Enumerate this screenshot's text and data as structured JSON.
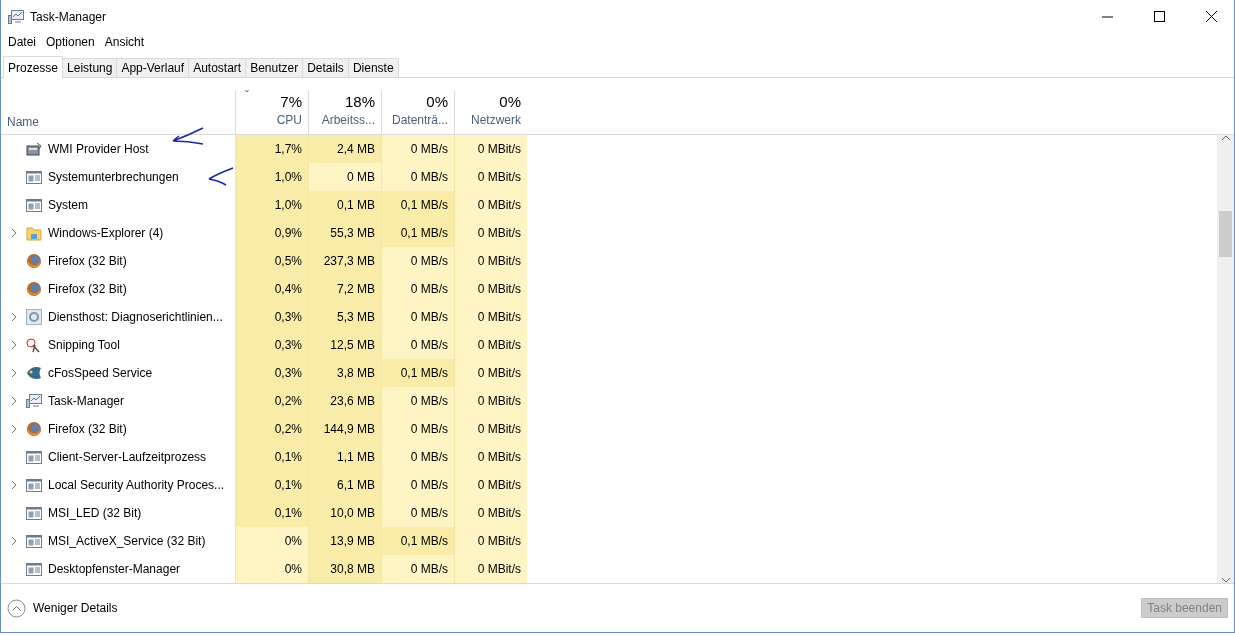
{
  "window": {
    "title": "Task-Manager"
  },
  "menu": [
    "Datei",
    "Optionen",
    "Ansicht"
  ],
  "tabs": [
    {
      "label": "Prozesse",
      "selected": true
    },
    {
      "label": "Leistung",
      "selected": false
    },
    {
      "label": "App-Verlauf",
      "selected": false
    },
    {
      "label": "Autostart",
      "selected": false
    },
    {
      "label": "Benutzer",
      "selected": false
    },
    {
      "label": "Details",
      "selected": false
    },
    {
      "label": "Dienste",
      "selected": false
    }
  ],
  "table": {
    "name_column": "Name",
    "sort_indicator": "ˇ",
    "columns": [
      {
        "total": "7%",
        "label": "CPU"
      },
      {
        "total": "18%",
        "label": "Arbeitss..."
      },
      {
        "total": "0%",
        "label": "Datenträ..."
      },
      {
        "total": "0%",
        "label": "Netzwerk"
      }
    ],
    "rows": [
      {
        "name": "WMI Provider Host",
        "kind": "service",
        "expandable": false,
        "cells": [
          {
            "text": "1,7%",
            "color": "#f9eca8"
          },
          {
            "text": "2,4 MB",
            "color": "#f9eca8"
          },
          {
            "text": "0 MB/s",
            "color": "#fff4c4"
          },
          {
            "text": "0 MBit/s",
            "color": "#fff4c4"
          }
        ]
      },
      {
        "name": "Systemunterbrechungen",
        "kind": "window",
        "expandable": false,
        "cells": [
          {
            "text": "1,0%",
            "color": "#f9eca8"
          },
          {
            "text": "0 MB",
            "color": "#fff4c4"
          },
          {
            "text": "0 MB/s",
            "color": "#fff4c4"
          },
          {
            "text": "0 MBit/s",
            "color": "#fff4c4"
          }
        ]
      },
      {
        "name": "System",
        "kind": "window",
        "expandable": false,
        "cells": [
          {
            "text": "1,0%",
            "color": "#f9eca8"
          },
          {
            "text": "0,1 MB",
            "color": "#f9eca8"
          },
          {
            "text": "0,1 MB/s",
            "color": "#f9eca8"
          },
          {
            "text": "0 MBit/s",
            "color": "#fff4c4"
          }
        ]
      },
      {
        "name": "Windows-Explorer (4)",
        "kind": "folder",
        "expandable": true,
        "cells": [
          {
            "text": "0,9%",
            "color": "#f9eca8"
          },
          {
            "text": "55,3 MB",
            "color": "#f9eca8"
          },
          {
            "text": "0,1 MB/s",
            "color": "#f9eca8"
          },
          {
            "text": "0 MBit/s",
            "color": "#fff4c4"
          }
        ]
      },
      {
        "name": "Firefox (32 Bit)",
        "kind": "globe",
        "expandable": false,
        "cells": [
          {
            "text": "0,5%",
            "color": "#f9eca8"
          },
          {
            "text": "237,3 MB",
            "color": "#f9eca8"
          },
          {
            "text": "0 MB/s",
            "color": "#fff4c4"
          },
          {
            "text": "0 MBit/s",
            "color": "#fff4c4"
          }
        ]
      },
      {
        "name": "Firefox (32 Bit)",
        "kind": "globe",
        "expandable": false,
        "cells": [
          {
            "text": "0,4%",
            "color": "#f9eca8"
          },
          {
            "text": "7,2 MB",
            "color": "#f9eca8"
          },
          {
            "text": "0 MB/s",
            "color": "#fff4c4"
          },
          {
            "text": "0 MBit/s",
            "color": "#fff4c4"
          }
        ]
      },
      {
        "name": "Diensthost: Diagnoserichtlinien...",
        "kind": "gear",
        "expandable": true,
        "cells": [
          {
            "text": "0,3%",
            "color": "#f9eca8"
          },
          {
            "text": "5,3 MB",
            "color": "#f9eca8"
          },
          {
            "text": "0 MB/s",
            "color": "#fff4c4"
          },
          {
            "text": "0 MBit/s",
            "color": "#fff4c4"
          }
        ]
      },
      {
        "name": "Snipping Tool",
        "kind": "scissors",
        "expandable": true,
        "cells": [
          {
            "text": "0,3%",
            "color": "#f9eca8"
          },
          {
            "text": "12,5 MB",
            "color": "#f9eca8"
          },
          {
            "text": "0 MB/s",
            "color": "#fff4c4"
          },
          {
            "text": "0 MBit/s",
            "color": "#fff4c4"
          }
        ]
      },
      {
        "name": "cFosSpeed Service",
        "kind": "fish",
        "expandable": true,
        "cells": [
          {
            "text": "0,3%",
            "color": "#f9eca8"
          },
          {
            "text": "3,8 MB",
            "color": "#f9eca8"
          },
          {
            "text": "0,1 MB/s",
            "color": "#f9eca8"
          },
          {
            "text": "0 MBit/s",
            "color": "#fff4c4"
          }
        ]
      },
      {
        "name": "Task-Manager",
        "kind": "monitor",
        "expandable": true,
        "cells": [
          {
            "text": "0,2%",
            "color": "#f9eca8"
          },
          {
            "text": "23,6 MB",
            "color": "#f9eca8"
          },
          {
            "text": "0 MB/s",
            "color": "#fff4c4"
          },
          {
            "text": "0 MBit/s",
            "color": "#fff4c4"
          }
        ]
      },
      {
        "name": "Firefox (32 Bit)",
        "kind": "globe",
        "expandable": true,
        "cells": [
          {
            "text": "0,2%",
            "color": "#f9eca8"
          },
          {
            "text": "144,9 MB",
            "color": "#f9eca8"
          },
          {
            "text": "0 MB/s",
            "color": "#fff4c4"
          },
          {
            "text": "0 MBit/s",
            "color": "#fff4c4"
          }
        ]
      },
      {
        "name": "Client-Server-Laufzeitprozess",
        "kind": "window",
        "expandable": false,
        "cells": [
          {
            "text": "0,1%",
            "color": "#f9eca8"
          },
          {
            "text": "1,1 MB",
            "color": "#f9eca8"
          },
          {
            "text": "0 MB/s",
            "color": "#fff4c4"
          },
          {
            "text": "0 MBit/s",
            "color": "#fff4c4"
          }
        ]
      },
      {
        "name": "Local Security Authority Proces...",
        "kind": "window",
        "expandable": true,
        "cells": [
          {
            "text": "0,1%",
            "color": "#f9eca8"
          },
          {
            "text": "6,1 MB",
            "color": "#f9eca8"
          },
          {
            "text": "0 MB/s",
            "color": "#fff4c4"
          },
          {
            "text": "0 MBit/s",
            "color": "#fff4c4"
          }
        ]
      },
      {
        "name": "MSI_LED (32 Bit)",
        "kind": "window",
        "expandable": false,
        "cells": [
          {
            "text": "0,1%",
            "color": "#f9eca8"
          },
          {
            "text": "10,0 MB",
            "color": "#f9eca8"
          },
          {
            "text": "0 MB/s",
            "color": "#fff4c4"
          },
          {
            "text": "0 MBit/s",
            "color": "#fff4c4"
          }
        ]
      },
      {
        "name": "MSI_ActiveX_Service (32 Bit)",
        "kind": "window",
        "expandable": true,
        "cells": [
          {
            "text": "0%",
            "color": "#fff4c4"
          },
          {
            "text": "13,9 MB",
            "color": "#f9eca8"
          },
          {
            "text": "0,1 MB/s",
            "color": "#f9eca8"
          },
          {
            "text": "0 MBit/s",
            "color": "#fff4c4"
          }
        ]
      },
      {
        "name": "Desktopfenster-Manager",
        "kind": "window",
        "expandable": false,
        "cells": [
          {
            "text": "0%",
            "color": "#fff4c4"
          },
          {
            "text": "30,8 MB",
            "color": "#f9eca8"
          },
          {
            "text": "0 MB/s",
            "color": "#fff4c4"
          },
          {
            "text": "0 MBit/s",
            "color": "#fff4c4"
          }
        ]
      }
    ]
  },
  "footer": {
    "details_toggle": "Weniger Details",
    "end_task": {
      "label": "Task beenden",
      "disabled": true
    }
  }
}
